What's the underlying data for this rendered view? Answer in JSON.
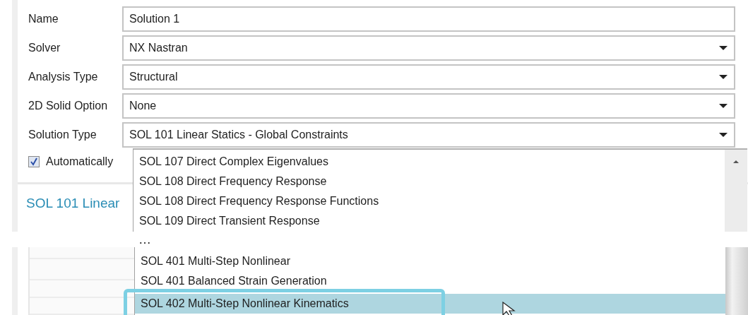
{
  "form": {
    "fields": [
      {
        "label": "Name",
        "value": "Solution 1",
        "kind": "text"
      },
      {
        "label": "Solver",
        "value": "NX Nastran",
        "kind": "dropdown"
      },
      {
        "label": "Analysis Type",
        "value": "Structural",
        "kind": "dropdown"
      },
      {
        "label": "2D Solid Option",
        "value": "None",
        "kind": "dropdown"
      },
      {
        "label": "Solution Type",
        "value": "SOL 101 Linear Statics - Global Constraints",
        "kind": "dropdown"
      }
    ],
    "checkbox": {
      "label": "Automatically",
      "checked": true
    },
    "section_title": "SOL 101 Linear"
  },
  "dropdown_list": {
    "items": [
      {
        "label": "SOL 107 Direct Complex Eigenvalues",
        "selected": false
      },
      {
        "label": "SOL 108 Direct Frequency Response",
        "selected": false
      },
      {
        "label": "SOL 108 Direct Frequency Response Functions",
        "selected": false
      },
      {
        "label": "SOL 109 Direct Transient Response",
        "selected": false
      }
    ]
  },
  "omission": "…",
  "continued_list": {
    "items": [
      {
        "label": "SOL 401 Multi-Step Nonlinear",
        "selected": false
      },
      {
        "label": "SOL 401 Balanced Strain Generation",
        "selected": false
      },
      {
        "label": "SOL 402 Multi-Step Nonlinear Kinematics",
        "selected": true
      }
    ]
  }
}
